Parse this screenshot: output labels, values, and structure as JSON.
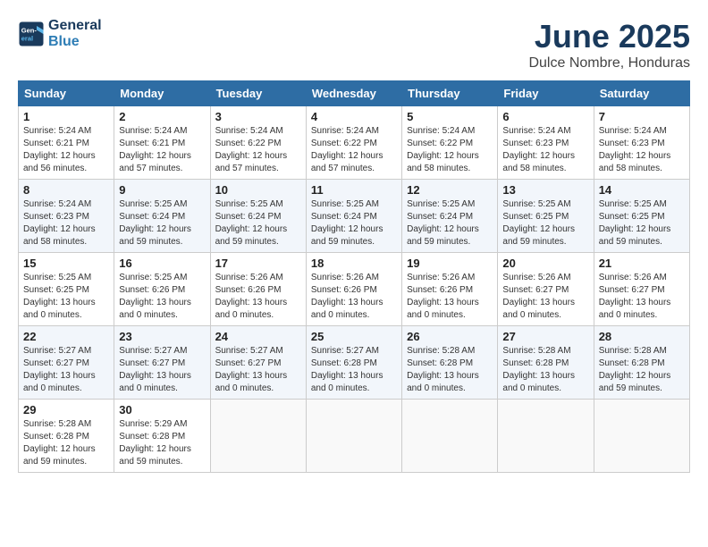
{
  "header": {
    "logo_line1": "General",
    "logo_line2": "Blue",
    "month": "June 2025",
    "location": "Dulce Nombre, Honduras"
  },
  "weekdays": [
    "Sunday",
    "Monday",
    "Tuesday",
    "Wednesday",
    "Thursday",
    "Friday",
    "Saturday"
  ],
  "weeks": [
    [
      {
        "day": "1",
        "sunrise": "5:24 AM",
        "sunset": "6:21 PM",
        "daylight": "12 hours and 56 minutes."
      },
      {
        "day": "2",
        "sunrise": "5:24 AM",
        "sunset": "6:21 PM",
        "daylight": "12 hours and 57 minutes."
      },
      {
        "day": "3",
        "sunrise": "5:24 AM",
        "sunset": "6:22 PM",
        "daylight": "12 hours and 57 minutes."
      },
      {
        "day": "4",
        "sunrise": "5:24 AM",
        "sunset": "6:22 PM",
        "daylight": "12 hours and 57 minutes."
      },
      {
        "day": "5",
        "sunrise": "5:24 AM",
        "sunset": "6:22 PM",
        "daylight": "12 hours and 58 minutes."
      },
      {
        "day": "6",
        "sunrise": "5:24 AM",
        "sunset": "6:23 PM",
        "daylight": "12 hours and 58 minutes."
      },
      {
        "day": "7",
        "sunrise": "5:24 AM",
        "sunset": "6:23 PM",
        "daylight": "12 hours and 58 minutes."
      }
    ],
    [
      {
        "day": "8",
        "sunrise": "5:24 AM",
        "sunset": "6:23 PM",
        "daylight": "12 hours and 58 minutes."
      },
      {
        "day": "9",
        "sunrise": "5:25 AM",
        "sunset": "6:24 PM",
        "daylight": "12 hours and 59 minutes."
      },
      {
        "day": "10",
        "sunrise": "5:25 AM",
        "sunset": "6:24 PM",
        "daylight": "12 hours and 59 minutes."
      },
      {
        "day": "11",
        "sunrise": "5:25 AM",
        "sunset": "6:24 PM",
        "daylight": "12 hours and 59 minutes."
      },
      {
        "day": "12",
        "sunrise": "5:25 AM",
        "sunset": "6:24 PM",
        "daylight": "12 hours and 59 minutes."
      },
      {
        "day": "13",
        "sunrise": "5:25 AM",
        "sunset": "6:25 PM",
        "daylight": "12 hours and 59 minutes."
      },
      {
        "day": "14",
        "sunrise": "5:25 AM",
        "sunset": "6:25 PM",
        "daylight": "12 hours and 59 minutes."
      }
    ],
    [
      {
        "day": "15",
        "sunrise": "5:25 AM",
        "sunset": "6:25 PM",
        "daylight": "13 hours and 0 minutes."
      },
      {
        "day": "16",
        "sunrise": "5:25 AM",
        "sunset": "6:26 PM",
        "daylight": "13 hours and 0 minutes."
      },
      {
        "day": "17",
        "sunrise": "5:26 AM",
        "sunset": "6:26 PM",
        "daylight": "13 hours and 0 minutes."
      },
      {
        "day": "18",
        "sunrise": "5:26 AM",
        "sunset": "6:26 PM",
        "daylight": "13 hours and 0 minutes."
      },
      {
        "day": "19",
        "sunrise": "5:26 AM",
        "sunset": "6:26 PM",
        "daylight": "13 hours and 0 minutes."
      },
      {
        "day": "20",
        "sunrise": "5:26 AM",
        "sunset": "6:27 PM",
        "daylight": "13 hours and 0 minutes."
      },
      {
        "day": "21",
        "sunrise": "5:26 AM",
        "sunset": "6:27 PM",
        "daylight": "13 hours and 0 minutes."
      }
    ],
    [
      {
        "day": "22",
        "sunrise": "5:27 AM",
        "sunset": "6:27 PM",
        "daylight": "13 hours and 0 minutes."
      },
      {
        "day": "23",
        "sunrise": "5:27 AM",
        "sunset": "6:27 PM",
        "daylight": "13 hours and 0 minutes."
      },
      {
        "day": "24",
        "sunrise": "5:27 AM",
        "sunset": "6:27 PM",
        "daylight": "13 hours and 0 minutes."
      },
      {
        "day": "25",
        "sunrise": "5:27 AM",
        "sunset": "6:28 PM",
        "daylight": "13 hours and 0 minutes."
      },
      {
        "day": "26",
        "sunrise": "5:28 AM",
        "sunset": "6:28 PM",
        "daylight": "13 hours and 0 minutes."
      },
      {
        "day": "27",
        "sunrise": "5:28 AM",
        "sunset": "6:28 PM",
        "daylight": "13 hours and 0 minutes."
      },
      {
        "day": "28",
        "sunrise": "5:28 AM",
        "sunset": "6:28 PM",
        "daylight": "12 hours and 59 minutes."
      }
    ],
    [
      {
        "day": "29",
        "sunrise": "5:28 AM",
        "sunset": "6:28 PM",
        "daylight": "12 hours and 59 minutes."
      },
      {
        "day": "30",
        "sunrise": "5:29 AM",
        "sunset": "6:28 PM",
        "daylight": "12 hours and 59 minutes."
      },
      null,
      null,
      null,
      null,
      null
    ]
  ]
}
